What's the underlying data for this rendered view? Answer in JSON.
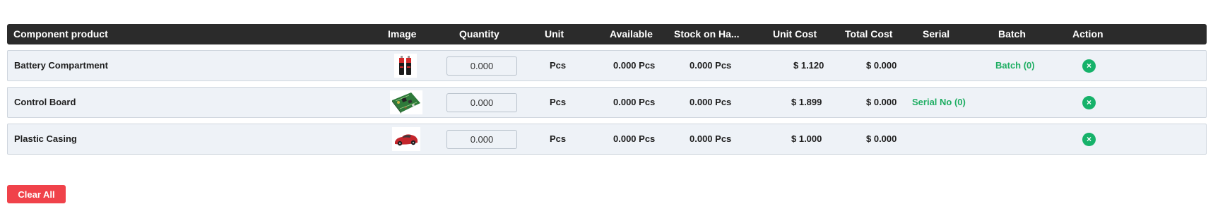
{
  "table": {
    "headers": {
      "component": "Component product",
      "image": "Image",
      "quantity": "Quantity",
      "unit": "Unit",
      "available": "Available",
      "stock_on_hand": "Stock on Ha...",
      "unit_cost": "Unit Cost",
      "total_cost": "Total Cost",
      "serial": "Serial",
      "batch": "Batch",
      "action": "Action"
    },
    "rows": [
      {
        "name": "Battery Compartment",
        "image_icon": "batteries-icon",
        "quantity": "0.000",
        "unit": "Pcs",
        "available": "0.000 Pcs",
        "stock_on_hand": "0.000 Pcs",
        "unit_cost": "$ 1.120",
        "total_cost": "$ 0.000",
        "serial": "",
        "batch": "Batch (0)"
      },
      {
        "name": "Control Board",
        "image_icon": "circuit-board-icon",
        "quantity": "0.000",
        "unit": "Pcs",
        "available": "0.000 Pcs",
        "stock_on_hand": "0.000 Pcs",
        "unit_cost": "$ 1.899",
        "total_cost": "$ 0.000",
        "serial": "Serial No (0)",
        "batch": ""
      },
      {
        "name": "Plastic Casing",
        "image_icon": "toy-car-icon",
        "quantity": "0.000",
        "unit": "Pcs",
        "available": "0.000 Pcs",
        "stock_on_hand": "0.000 Pcs",
        "unit_cost": "$ 1.000",
        "total_cost": "$ 0.000",
        "serial": "",
        "batch": ""
      }
    ],
    "remove_icon": "close-icon"
  },
  "actions": {
    "clear_all_label": "Clear All"
  },
  "colors": {
    "header_bg": "#2b2b2b",
    "row_bg": "#eef2f7",
    "link_green": "#1fae63",
    "remove_green": "#16b26a",
    "clear_red": "#f0424a"
  }
}
